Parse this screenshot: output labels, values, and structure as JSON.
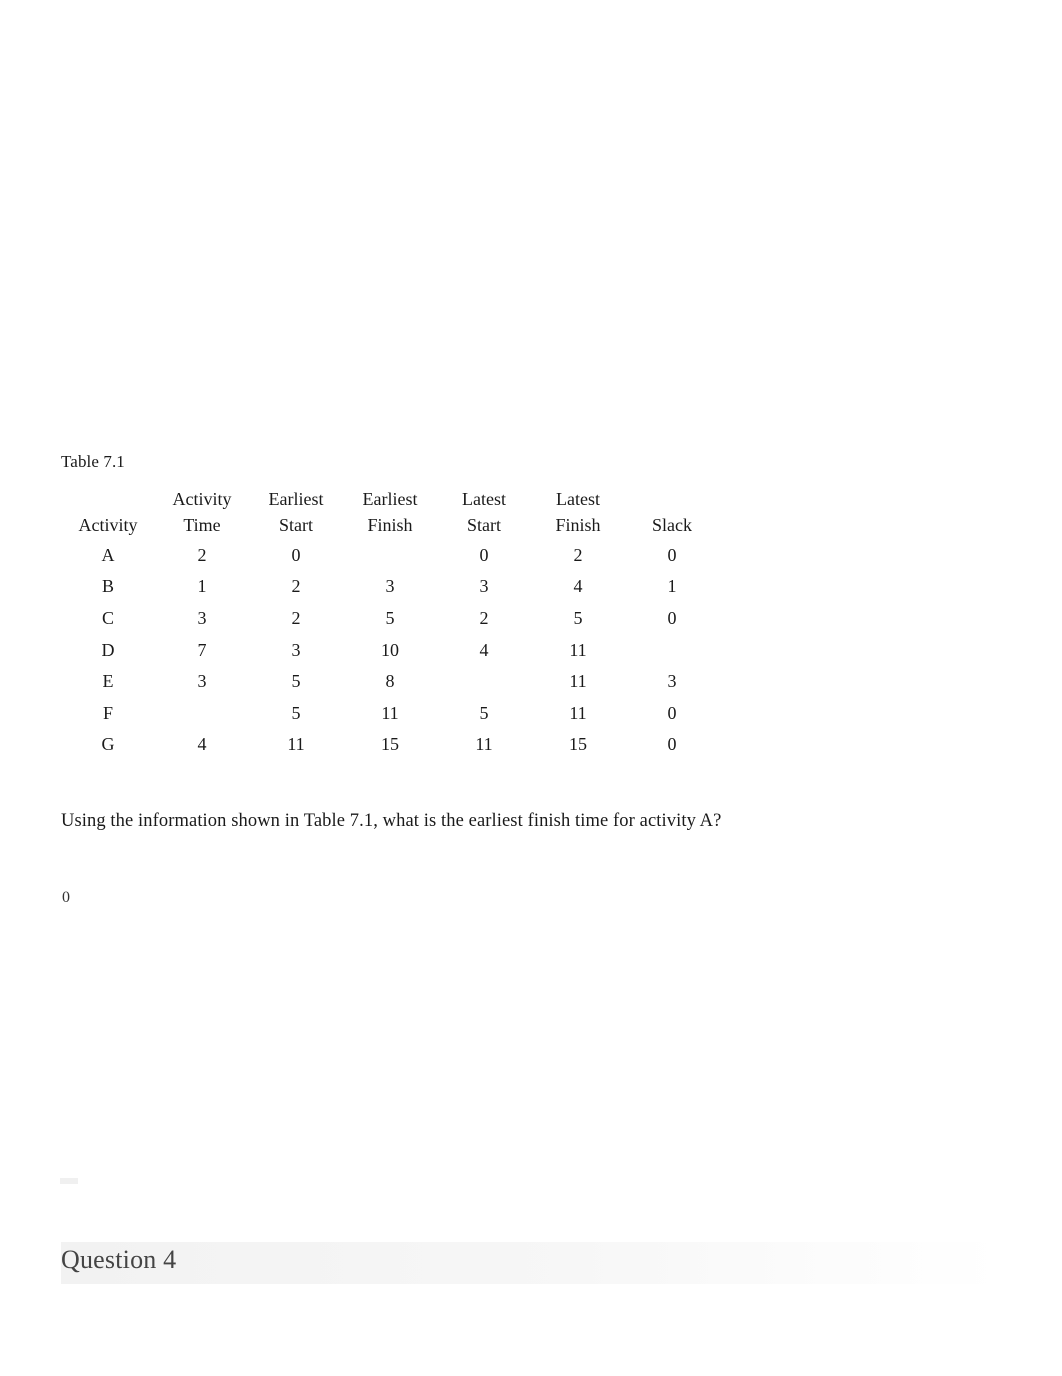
{
  "document": {
    "table_caption": "Table 7.1",
    "table": {
      "headers": [
        "Activity",
        "Activity Time",
        "Earliest Start",
        "Earliest Finish",
        "Latest Start",
        "Latest Finish",
        "Slack"
      ],
      "headers_line1": [
        "",
        "Activity",
        "Earliest",
        "Earliest",
        "Latest",
        "Latest",
        ""
      ],
      "headers_line2": [
        "Activity",
        "Time",
        "Start",
        "Finish",
        "Start",
        "Finish",
        "Slack"
      ],
      "rows": [
        {
          "activity": "A",
          "activity_time": "2",
          "earliest_start": "0",
          "earliest_finish": "",
          "latest_start": "0",
          "latest_finish": "2",
          "slack": "0"
        },
        {
          "activity": "B",
          "activity_time": "1",
          "earliest_start": "2",
          "earliest_finish": "3",
          "latest_start": "3",
          "latest_finish": "4",
          "slack": "1"
        },
        {
          "activity": "C",
          "activity_time": "3",
          "earliest_start": "2",
          "earliest_finish": "5",
          "latest_start": "2",
          "latest_finish": "5",
          "slack": "0"
        },
        {
          "activity": "D",
          "activity_time": "7",
          "earliest_start": "3",
          "earliest_finish": "10",
          "latest_start": "4",
          "latest_finish": "11",
          "slack": ""
        },
        {
          "activity": "E",
          "activity_time": "3",
          "earliest_start": "5",
          "earliest_finish": "8",
          "latest_start": "",
          "latest_finish": "11",
          "slack": "3"
        },
        {
          "activity": "F",
          "activity_time": "",
          "earliest_start": "5",
          "earliest_finish": "11",
          "latest_start": "5",
          "latest_finish": "11",
          "slack": "0"
        },
        {
          "activity": "G",
          "activity_time": "4",
          "earliest_start": "11",
          "earliest_finish": "15",
          "latest_start": "11",
          "latest_finish": "15",
          "slack": "0"
        }
      ]
    },
    "question": "Using the information shown in Table 7.1, what is the earliest finish time for activity A?",
    "answer": "0",
    "section_title": "Question 4"
  }
}
